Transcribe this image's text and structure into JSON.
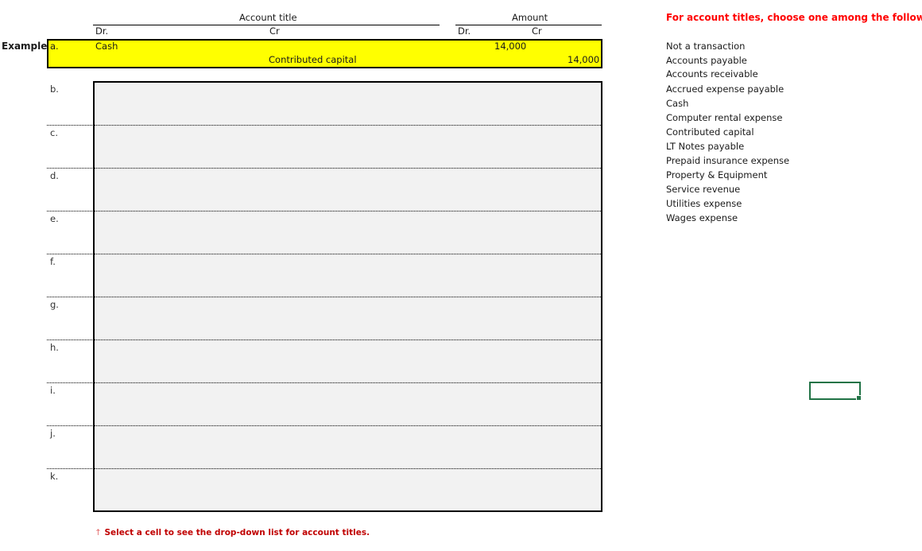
{
  "header": {
    "account_title": "Account title",
    "amount": "Amount",
    "dr_label": "Dr.",
    "cr_label": "Cr",
    "amount_dr_label": "Dr.",
    "amount_cr_label": "Cr"
  },
  "example": {
    "label": "Example",
    "row_letter": "a.",
    "debit_account": "Cash",
    "credit_account": "Contributed capital",
    "debit_amount": "14,000",
    "credit_amount": "14,000",
    "highlight_color": "#ffff00"
  },
  "rows": [
    {
      "letter": "b."
    },
    {
      "letter": "c."
    },
    {
      "letter": "d."
    },
    {
      "letter": "e."
    },
    {
      "letter": "f."
    },
    {
      "letter": "g."
    },
    {
      "letter": "h."
    },
    {
      "letter": "i."
    },
    {
      "letter": "j."
    },
    {
      "letter": "k."
    }
  ],
  "instructions": {
    "title": "For account titles, choose one among the following:",
    "options": [
      "Not a transaction",
      "Accounts payable",
      "Accounts receivable",
      "Accrued expense payable",
      "Cash",
      "Computer rental expense",
      "Contributed capital",
      "LT Notes payable",
      "Prepaid insurance expense",
      "Property & Equipment",
      "Service revenue",
      "Utilities expense",
      "Wages expense"
    ],
    "title_color": "#ff0000"
  },
  "footer_note": {
    "arrow": "↑",
    "text": "Select a cell to see the drop-down list for account titles.",
    "color": "#c00000"
  },
  "selection": {
    "color": "#217346"
  }
}
